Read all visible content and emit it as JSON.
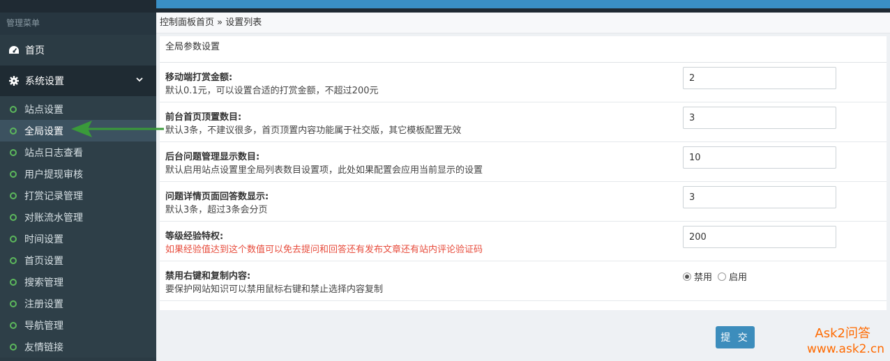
{
  "sidebar": {
    "menu_title": "管理菜单",
    "home_label": "首页",
    "system_label": "系统设置",
    "items": [
      {
        "label": "站点设置"
      },
      {
        "label": "全局设置"
      },
      {
        "label": "站点日志查看"
      },
      {
        "label": "用户提现审核"
      },
      {
        "label": "打赏记录管理"
      },
      {
        "label": "对账流水管理"
      },
      {
        "label": "时间设置"
      },
      {
        "label": "首页设置"
      },
      {
        "label": "搜索管理"
      },
      {
        "label": "注册设置"
      },
      {
        "label": "导航管理"
      },
      {
        "label": "友情链接"
      }
    ],
    "active_index": 1
  },
  "breadcrumb": {
    "home": "控制面板首页",
    "separator": "»",
    "current": "设置列表"
  },
  "panel": {
    "title": "全局参数设置",
    "rows": [
      {
        "label": "移动端打赏金额:",
        "desc": "默认0.1元，可以设置合适的打赏金额，不超过200元",
        "value": "2"
      },
      {
        "label": "前台首页顶置数目:",
        "desc": "默认3条，不建议很多，首页顶置内容功能属于社交版，其它模板配置无效",
        "value": "3"
      },
      {
        "label": "后台问题管理显示数目:",
        "desc": "默认启用站点设置里全局列表数目设置项，此处如果配置会应用当前显示的设置",
        "value": "10"
      },
      {
        "label": "问题详情页面回答数显示:",
        "desc": "默认3条，超过3条会分页",
        "value": "3"
      },
      {
        "label": "等级经验特权:",
        "desc": "如果经验值达到这个数值可以免去提问和回答还有发布文章还有站内评论验证码",
        "value": "200"
      }
    ],
    "copy_row": {
      "label": "禁用右键和复制内容:",
      "desc": "要保护网站知识可以禁用鼠标右键和禁止选择内容复制",
      "option_disable": "禁用",
      "option_enable": "启用",
      "selected": "禁用"
    }
  },
  "submit_label": "提 交",
  "watermark": {
    "line1": "Ask2问答",
    "line2": "www.ask2.cn"
  },
  "colors": {
    "sidebar_bg": "#2b3b44",
    "accent_blue": "#3a8fc5",
    "active_item": "#3c5260",
    "dot_green": "#5cb85c",
    "warning_red": "#e74c3c",
    "arrow_green": "#3a9a3a",
    "watermark_orange": "#ff6a00"
  }
}
